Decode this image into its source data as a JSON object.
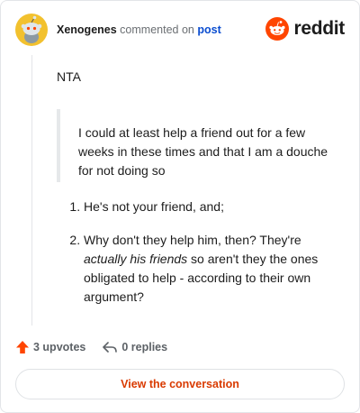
{
  "header": {
    "author": "Xenogenes",
    "action_text": "commented on",
    "post_link": "post",
    "brand": "reddit"
  },
  "comment": {
    "verdict": "NTA",
    "quote": "I could at least help a friend out for a few weeks in these times and that I am a douche for not doing so",
    "list": [
      {
        "text": "He's not your friend, and;"
      },
      {
        "before": "Why don't they help him, then? They're ",
        "emphasis": "actually his friends",
        "after": " so aren't they the ones obligated to help - according to their own argument?"
      }
    ]
  },
  "footer": {
    "upvotes": "3 upvotes",
    "replies": "0 replies",
    "upvote_icon": "upvote-arrow-icon",
    "reply_icon": "reply-arrow-icon"
  },
  "cta": {
    "label": "View the conversation"
  },
  "colors": {
    "accent": "#ff4500",
    "link": "#0b4dd0",
    "cta_text": "#d93a00",
    "snoo_bg": "#f2c12e"
  }
}
